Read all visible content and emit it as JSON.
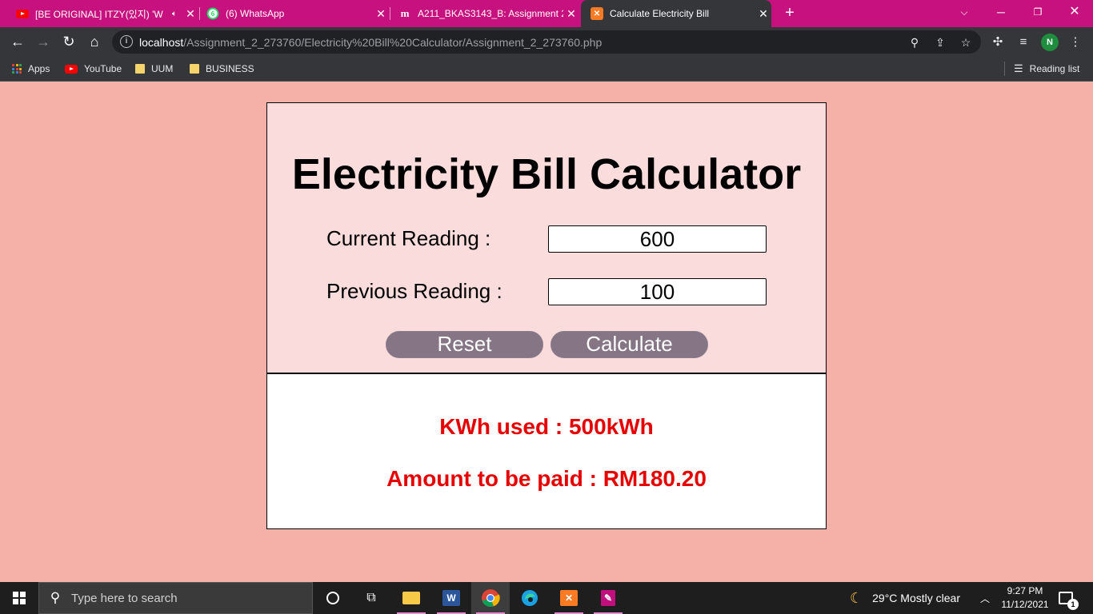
{
  "browser": {
    "tabs": [
      {
        "title": "[BE ORIGINAL] ITZY(있지) 'W",
        "icon": "youtube-icon",
        "audio": true,
        "active": false
      },
      {
        "title": "(6) WhatsApp",
        "icon": "whatsapp-icon",
        "badge": "6",
        "active": false
      },
      {
        "title": "A211_BKAS3143_B: Assignment 2",
        "icon": "moodle-icon",
        "active": false
      },
      {
        "title": "Calculate Electricity Bill",
        "icon": "xampp-icon",
        "active": true
      }
    ],
    "url_host": "localhost",
    "url_path": "/Assignment_2_273760/Electricity%20Bill%20Calculator/Assignment_2_273760.php",
    "profile_initial": "N",
    "bookmarks": [
      {
        "label": "Apps",
        "icon": "apps-grid-icon"
      },
      {
        "label": "YouTube",
        "icon": "youtube-icon"
      },
      {
        "label": "UUM",
        "icon": "folder-icon"
      },
      {
        "label": "BUSINESS",
        "icon": "folder-icon"
      }
    ],
    "reading_list": "Reading list"
  },
  "calculator": {
    "title": "Electricity Bill Calculator",
    "current_label": "Current Reading :",
    "current_value": "600",
    "previous_label": "Previous Reading :",
    "previous_value": "100",
    "reset_label": "Reset",
    "calculate_label": "Calculate"
  },
  "result": {
    "kwh_text": "KWh used : 500kWh",
    "amount_text": "Amount to be paid : RM180.20"
  },
  "taskbar": {
    "search_placeholder": "Type here to search",
    "weather": "29°C  Mostly clear",
    "time": "9:27 PM",
    "date": "11/12/2021",
    "notification_count": "1"
  },
  "colors": {
    "tab_strip": "#c7117f",
    "page_bg": "#f5b0a7",
    "panel_bg": "#fbdcdc",
    "button_bg": "#857585",
    "result_text": "#e60000"
  }
}
